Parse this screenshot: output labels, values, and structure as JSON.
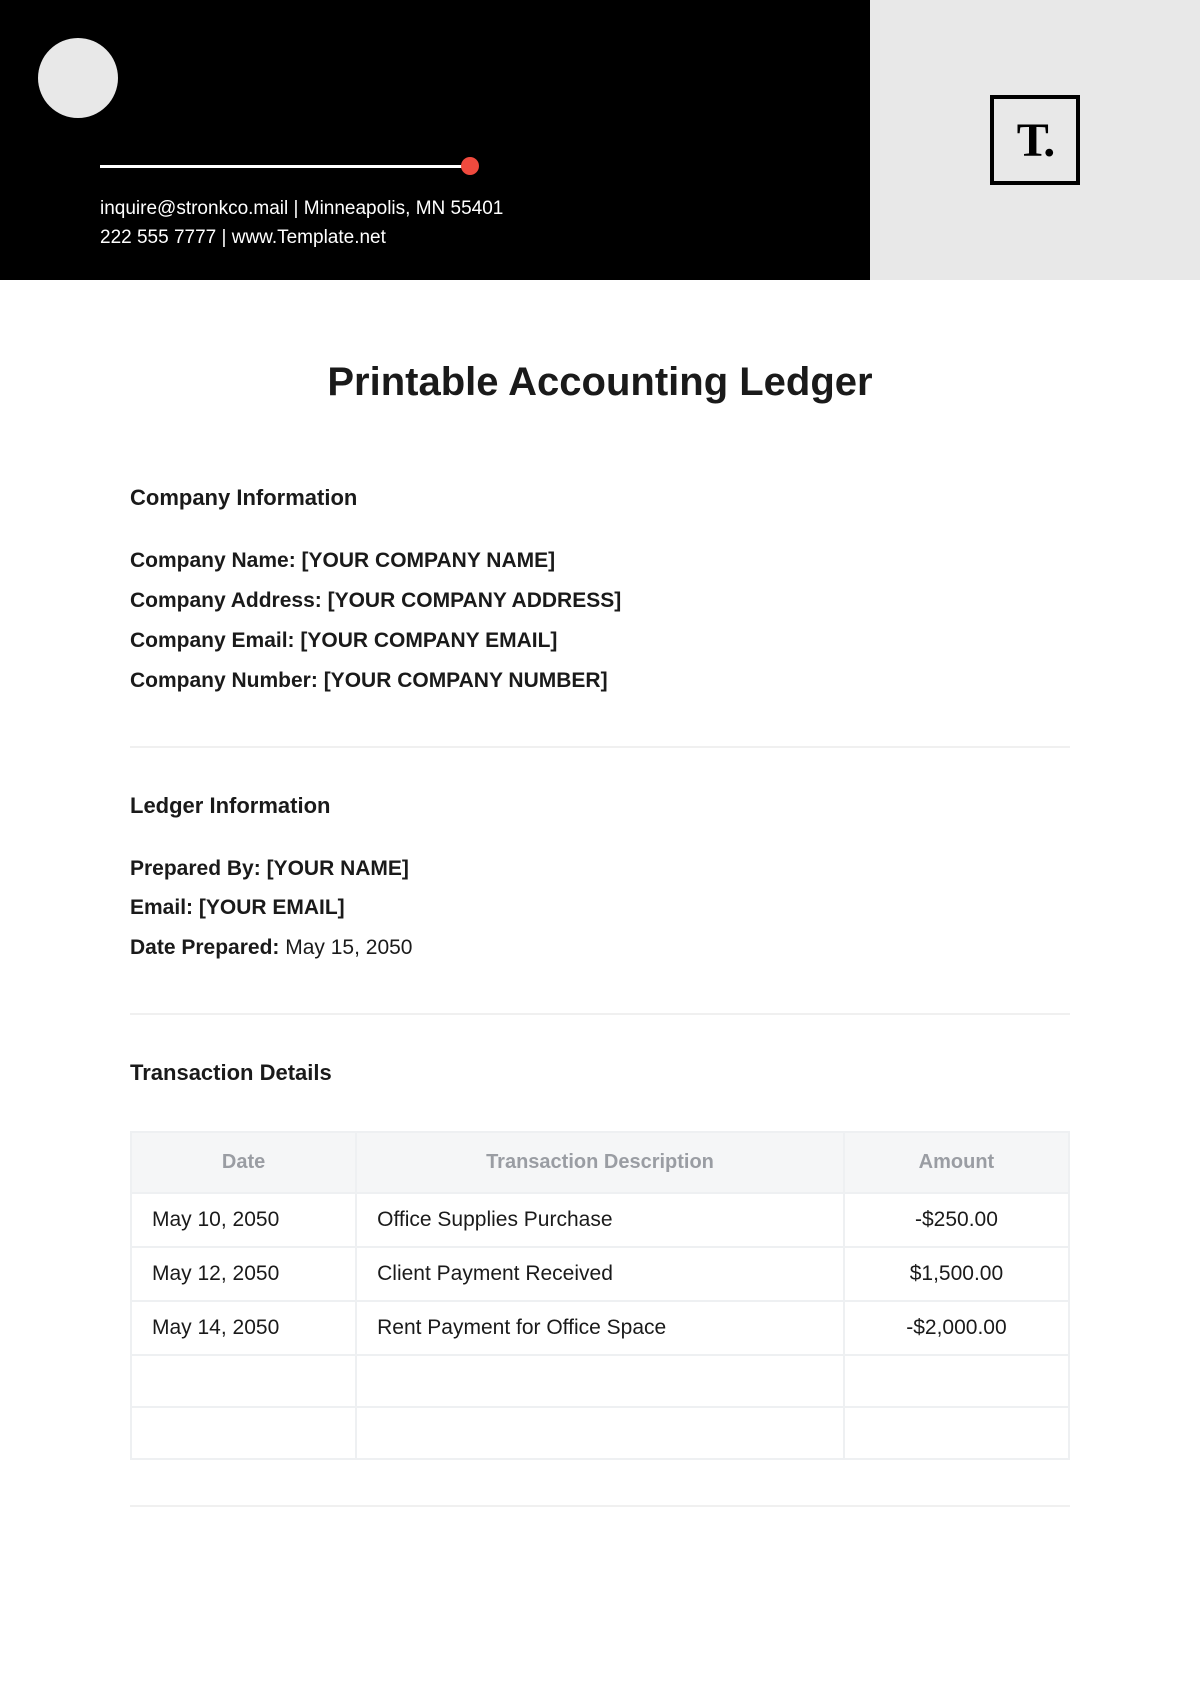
{
  "header": {
    "contact_line1": "inquire@stronkco.mail | Minneapolis, MN 55401",
    "contact_line2": "222 555 7777 |  www.Template.net",
    "logo_text": "T."
  },
  "title": "Printable Accounting Ledger",
  "company_info": {
    "heading": "Company Information",
    "name_label": "Company Name: ",
    "name_value": "[YOUR COMPANY NAME]",
    "address_label": "Company Address: ",
    "address_value": "[YOUR COMPANY ADDRESS]",
    "email_label": "Company Email: ",
    "email_value": "[YOUR COMPANY EMAIL]",
    "number_label": "Company Number: ",
    "number_value": "[YOUR COMPANY NUMBER]"
  },
  "ledger_info": {
    "heading": "Ledger Information",
    "prepared_by_label": "Prepared By: ",
    "prepared_by_value": "[YOUR NAME]",
    "email_label": "Email: ",
    "email_value": "[YOUR EMAIL]",
    "date_label": "Date Prepared: ",
    "date_value": "May 15, 2050"
  },
  "transactions": {
    "heading": "Transaction Details",
    "columns": {
      "date": "Date",
      "description": "Transaction Description",
      "amount": "Amount"
    },
    "rows": [
      {
        "date": "May 10, 2050",
        "description": "Office Supplies Purchase",
        "amount": "-$250.00"
      },
      {
        "date": "May 12, 2050",
        "description": "Client Payment Received",
        "amount": "$1,500.00"
      },
      {
        "date": "May 14, 2050",
        "description": "Rent Payment for Office Space",
        "amount": "-$2,000.00"
      },
      {
        "date": "",
        "description": "",
        "amount": ""
      },
      {
        "date": "",
        "description": "",
        "amount": ""
      }
    ]
  }
}
